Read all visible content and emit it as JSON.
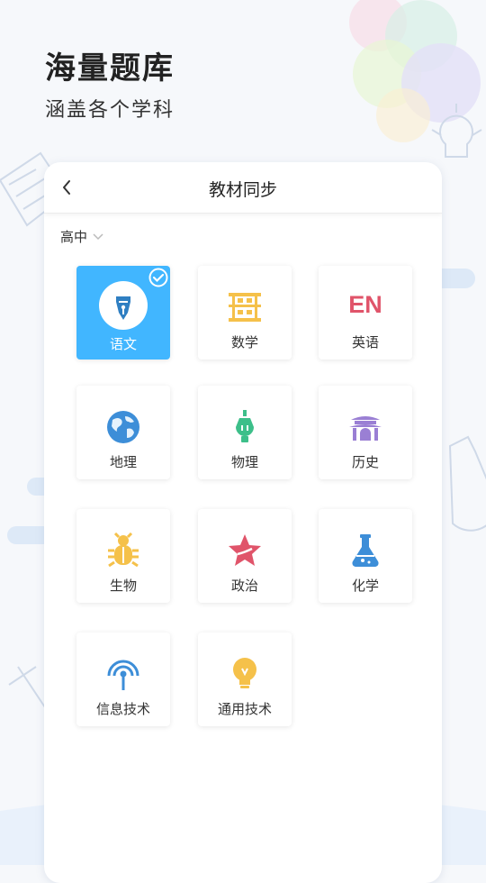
{
  "hero": {
    "title": "海量题库",
    "subtitle": "涵盖各个学科"
  },
  "header": {
    "title": "教材同步"
  },
  "grade": {
    "selected": "高中"
  },
  "colors": {
    "selected_tile": "#41b6ff",
    "math": "#f5c14a",
    "english": "#e0546a",
    "geography": "#3d8ed8",
    "physics": "#3dbf8a",
    "history": "#9a7fd4",
    "biology": "#f5c14a",
    "politics": "#e0546a",
    "chemistry": "#3d8ed8",
    "it": "#3d8ed8",
    "general_tech": "#f5c14a"
  },
  "subjects": [
    {
      "label": "语文",
      "icon": "pen-nib-icon",
      "selected": true
    },
    {
      "label": "数学",
      "icon": "abacus-icon",
      "selected": false,
      "icon_text": ""
    },
    {
      "label": "英语",
      "icon": "en-text-icon",
      "selected": false,
      "icon_text": "EN"
    },
    {
      "label": "地理",
      "icon": "globe-icon",
      "selected": false
    },
    {
      "label": "物理",
      "icon": "lightbulb-plug-icon",
      "selected": false
    },
    {
      "label": "历史",
      "icon": "pagoda-icon",
      "selected": false
    },
    {
      "label": "生物",
      "icon": "bug-icon",
      "selected": false
    },
    {
      "label": "政治",
      "icon": "star-icon",
      "selected": false
    },
    {
      "label": "化学",
      "icon": "flask-icon",
      "selected": false
    },
    {
      "label": "信息技术",
      "icon": "signal-antenna-icon",
      "selected": false
    },
    {
      "label": "通用技术",
      "icon": "bulb-icon",
      "selected": false
    }
  ]
}
